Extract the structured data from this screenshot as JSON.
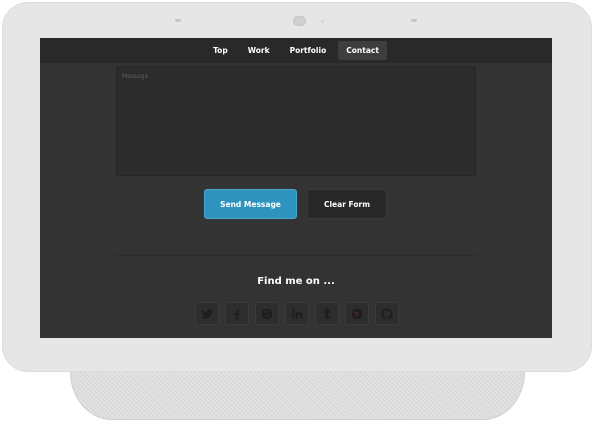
{
  "nav": {
    "items": [
      "Top",
      "Work",
      "Portfolio",
      "Contact"
    ],
    "active": "Contact"
  },
  "form": {
    "message_placeholder": "Message",
    "send_label": "Send Message",
    "clear_label": "Clear Form"
  },
  "social": {
    "title": "Find me on ...",
    "icons": [
      "twitter-icon",
      "facebook-icon",
      "stumbleupon-icon",
      "linkedin-icon",
      "tumblr-icon",
      "google-plus-icon",
      "github-icon"
    ]
  },
  "colors": {
    "accent": "#2e93bd",
    "background": "#333333",
    "navbar": "#292929"
  }
}
